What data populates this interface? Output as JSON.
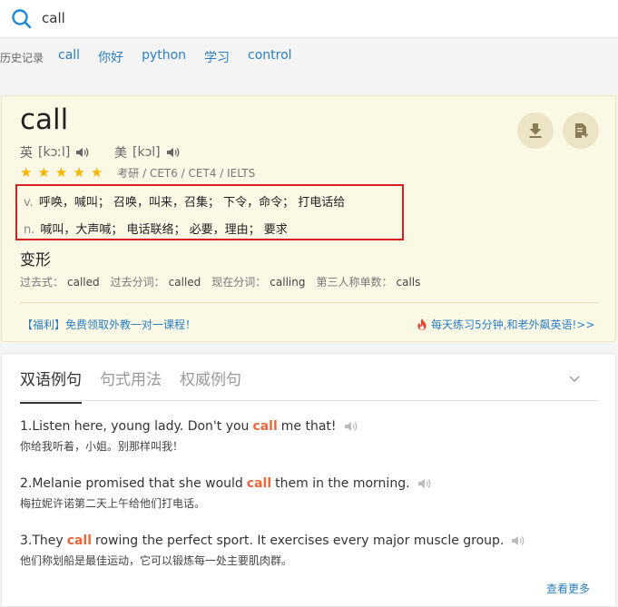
{
  "search": {
    "value": "call"
  },
  "history": {
    "label": "历史记录",
    "items": [
      "call",
      "你好",
      "python",
      "学习",
      "control"
    ]
  },
  "entry": {
    "word": "call",
    "uk_label": "英",
    "uk_phonetic": "[kɔːl]",
    "us_label": "美",
    "us_phonetic": "[kɔl]",
    "stars": 5,
    "tags": "考研 / CET6 / CET4 / IELTS",
    "definitions": [
      {
        "pos": "v.",
        "text": "呼唤，喊叫； 召唤，叫来，召集； 下令，命令； 打电话给"
      },
      {
        "pos": "n.",
        "text": "喊叫，大声喊； 电话联络； 必要，理由； 要求"
      }
    ],
    "forms_title": "变形",
    "forms": [
      {
        "label": "过去式：",
        "value": "called"
      },
      {
        "label": "过去分词：",
        "value": "called"
      },
      {
        "label": "现在分词：",
        "value": "calling"
      },
      {
        "label": "第三人称单数：",
        "value": "calls"
      }
    ],
    "promo_left": "【福利】免费领取外教一对一课程！",
    "promo_right": "每天练习5分钟,和老外飙英语!>>"
  },
  "examples": {
    "tabs": [
      "双语例句",
      "句式用法",
      "权威例句"
    ],
    "items": [
      {
        "before": "1.Listen here, young lady. Don't you",
        "keyword": "call",
        "after": "me that!",
        "zh": "你给我听着，小姐。别那样叫我！"
      },
      {
        "before": "2.Melanie promised that she would",
        "keyword": "call",
        "after": "them in the morning.",
        "zh": "梅拉妮许诺第二天上午给他们打电话。"
      },
      {
        "before": "3.They",
        "keyword": "call",
        "after": "rowing the perfect sport. It exercises every major muscle group.",
        "zh": "他们称划船是最佳运动，它可以锻炼每一处主要肌肉群。"
      }
    ],
    "more": "查看更多"
  },
  "colors": {
    "accent": "#2a7fc1",
    "highlight": "#e8683c",
    "star": "#f4b400",
    "card_bg": "#fbf8e6",
    "def_border": "#d62020"
  }
}
